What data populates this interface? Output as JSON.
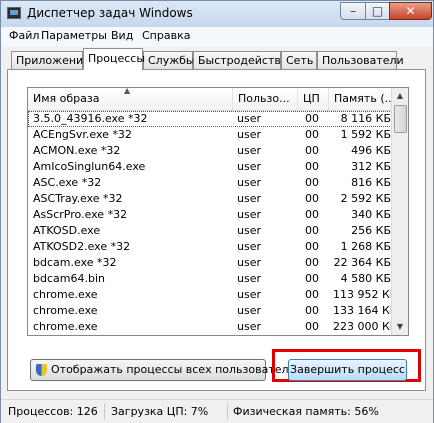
{
  "window": {
    "title": "Диспетчер задач Windows"
  },
  "menu": [
    "Файл",
    "Параметры",
    "Вид",
    "Справка"
  ],
  "tabs": [
    "Приложения",
    "Процессы",
    "Службы",
    "Быстродействие",
    "Сеть",
    "Пользователи"
  ],
  "active_tab": "Процессы",
  "columns": {
    "name": "Имя образа",
    "user": "Пользо...",
    "cpu": "ЦП",
    "mem": "Память (..."
  },
  "rows": [
    {
      "name": "3.5.0_43916.exe *32",
      "user": "user",
      "cpu": "00",
      "mem": "8 116 КБ",
      "selected": true
    },
    {
      "name": "ACEngSvr.exe *32",
      "user": "user",
      "cpu": "00",
      "mem": "1 592 КБ"
    },
    {
      "name": "ACMON.exe *32",
      "user": "user",
      "cpu": "00",
      "mem": "496 КБ"
    },
    {
      "name": "AmIcoSinglun64.exe",
      "user": "user",
      "cpu": "00",
      "mem": "312 КБ"
    },
    {
      "name": "ASC.exe *32",
      "user": "user",
      "cpu": "00",
      "mem": "816 КБ"
    },
    {
      "name": "ASCTray.exe *32",
      "user": "user",
      "cpu": "00",
      "mem": "2 592 КБ"
    },
    {
      "name": "AsScrPro.exe *32",
      "user": "user",
      "cpu": "00",
      "mem": "340 КБ"
    },
    {
      "name": "ATKOSD.exe",
      "user": "user",
      "cpu": "00",
      "mem": "256 КБ"
    },
    {
      "name": "ATKOSD2.exe *32",
      "user": "user",
      "cpu": "00",
      "mem": "1 268 КБ"
    },
    {
      "name": "bdcam.exe *32",
      "user": "user",
      "cpu": "00",
      "mem": "22 364 КБ"
    },
    {
      "name": "bdcam64.bin",
      "user": "user",
      "cpu": "00",
      "mem": "4 580 КБ"
    },
    {
      "name": "chrome.exe",
      "user": "user",
      "cpu": "00",
      "mem": "113 952 КБ"
    },
    {
      "name": "chrome.exe",
      "user": "user",
      "cpu": "00",
      "mem": "133 164 КБ"
    },
    {
      "name": "chrome.exe",
      "user": "user",
      "cpu": "00",
      "mem": "223 000 КБ"
    }
  ],
  "buttons": {
    "show_all": "Отображать процессы всех пользователей",
    "end_process": "Завершить процесс"
  },
  "status": {
    "processes": "Процессов: 126",
    "cpu": "Загрузка ЦП: 7%",
    "memory": "Физическая память: 56%"
  },
  "caption_buttons": {
    "minimize": "–",
    "maximize": "□",
    "close": "✕"
  },
  "colors": {
    "highlight_border": "#e00000",
    "end_button": "#b9dcf7"
  }
}
